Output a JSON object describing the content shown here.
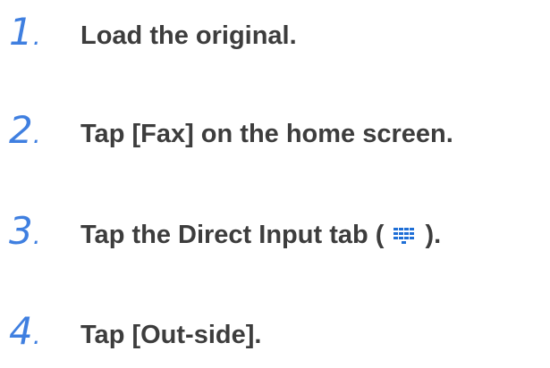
{
  "steps": [
    {
      "number": "1",
      "dot": ".",
      "text": "Load the original."
    },
    {
      "number": "2",
      "dot": ".",
      "text": "Tap [Fax] on the home screen."
    },
    {
      "number": "3",
      "dot": ".",
      "text_before": "Tap the Direct Input tab ( ",
      "icon": "keypad-icon",
      "text_after": " )."
    },
    {
      "number": "4",
      "dot": ".",
      "text": "Tap [Out-side]."
    }
  ],
  "colors": {
    "step_number": "#3f7fe0",
    "step_text": "#3d3d3d",
    "icon": "#1f6fd6"
  }
}
